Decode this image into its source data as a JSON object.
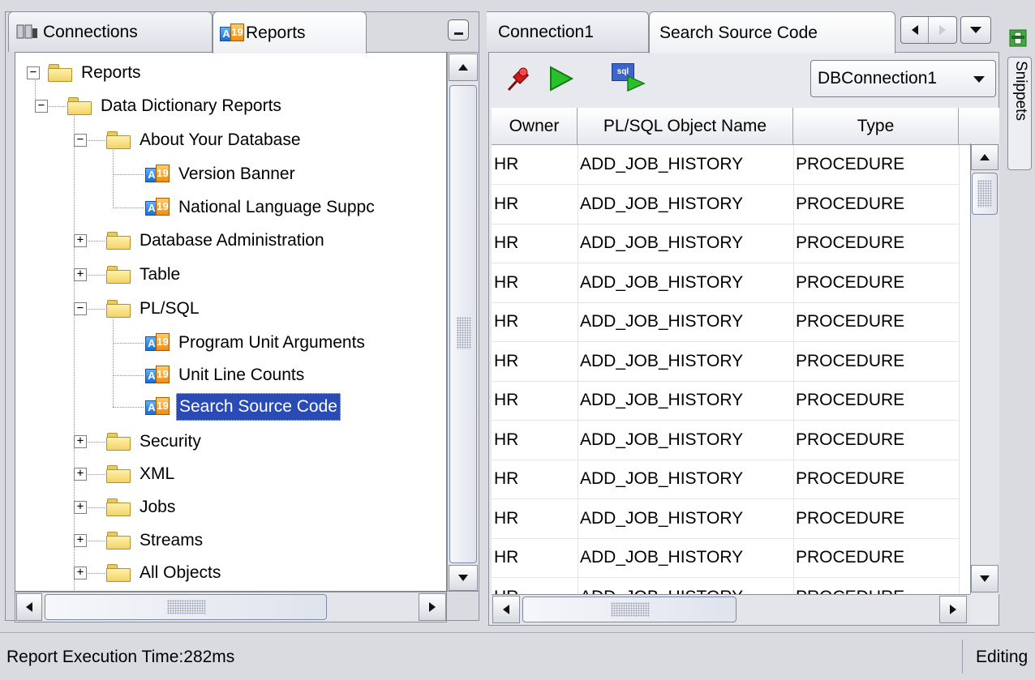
{
  "left_panel": {
    "tabs": [
      {
        "label": "Connections",
        "icon": "connections-icon"
      },
      {
        "label": "Reports",
        "icon": "reports-icon"
      }
    ],
    "minimize_icon": "minimize-icon",
    "tree": [
      {
        "label": "Reports",
        "type": "folder",
        "expanded": true
      },
      {
        "label": "Data Dictionary Reports",
        "type": "folder",
        "expanded": true
      },
      {
        "label": "About Your Database",
        "type": "folder",
        "expanded": true
      },
      {
        "label": "Version Banner",
        "type": "report"
      },
      {
        "label": "National Language Suppc",
        "type": "report"
      },
      {
        "label": "Database Administration",
        "type": "folder",
        "expanded": false
      },
      {
        "label": "Table",
        "type": "folder",
        "expanded": false
      },
      {
        "label": "PL/SQL",
        "type": "folder",
        "expanded": true
      },
      {
        "label": "Program Unit Arguments",
        "type": "report"
      },
      {
        "label": "Unit Line Counts",
        "type": "report"
      },
      {
        "label": "Search Source Code",
        "type": "report",
        "selected": true
      },
      {
        "label": "Security",
        "type": "folder",
        "expanded": false
      },
      {
        "label": "XML",
        "type": "folder",
        "expanded": false
      },
      {
        "label": "Jobs",
        "type": "folder",
        "expanded": false
      },
      {
        "label": "Streams",
        "type": "folder",
        "expanded": false
      },
      {
        "label": "All Objects",
        "type": "folder",
        "expanded": false
      }
    ]
  },
  "right_panel": {
    "tabs": [
      {
        "label": "Connection1"
      },
      {
        "label": "Search Source Code"
      }
    ],
    "toolbar": {
      "pin_icon": "pin-icon",
      "run_icon": "run-icon",
      "sql_icon": "run-sql-icon",
      "sql_icon_text": "sql",
      "connection_value": "DBConnection1"
    },
    "columns": [
      "Owner",
      "PL/SQL Object Name",
      "Type"
    ],
    "rows": [
      [
        "HR",
        "ADD_JOB_HISTORY",
        "PROCEDURE"
      ],
      [
        "HR",
        "ADD_JOB_HISTORY",
        "PROCEDURE"
      ],
      [
        "HR",
        "ADD_JOB_HISTORY",
        "PROCEDURE"
      ],
      [
        "HR",
        "ADD_JOB_HISTORY",
        "PROCEDURE"
      ],
      [
        "HR",
        "ADD_JOB_HISTORY",
        "PROCEDURE"
      ],
      [
        "HR",
        "ADD_JOB_HISTORY",
        "PROCEDURE"
      ],
      [
        "HR",
        "ADD_JOB_HISTORY",
        "PROCEDURE"
      ],
      [
        "HR",
        "ADD_JOB_HISTORY",
        "PROCEDURE"
      ],
      [
        "HR",
        "ADD_JOB_HISTORY",
        "PROCEDURE"
      ],
      [
        "HR",
        "ADD_JOB_HISTORY",
        "PROCEDURE"
      ],
      [
        "HR",
        "ADD_JOB_HISTORY",
        "PROCEDURE"
      ],
      [
        "HR",
        "ADD_JOB_HISTORY",
        "PROCEDURE"
      ]
    ]
  },
  "snippets": {
    "label": "Snippets",
    "icon": "snippets-icon"
  },
  "status": {
    "execution_time": "Report Execution Time:282ms",
    "mode": "Editing"
  },
  "colors": {
    "selection": "#2a4bb3",
    "run_green": "#2bbf2b",
    "pin_red": "#d21a1a"
  }
}
